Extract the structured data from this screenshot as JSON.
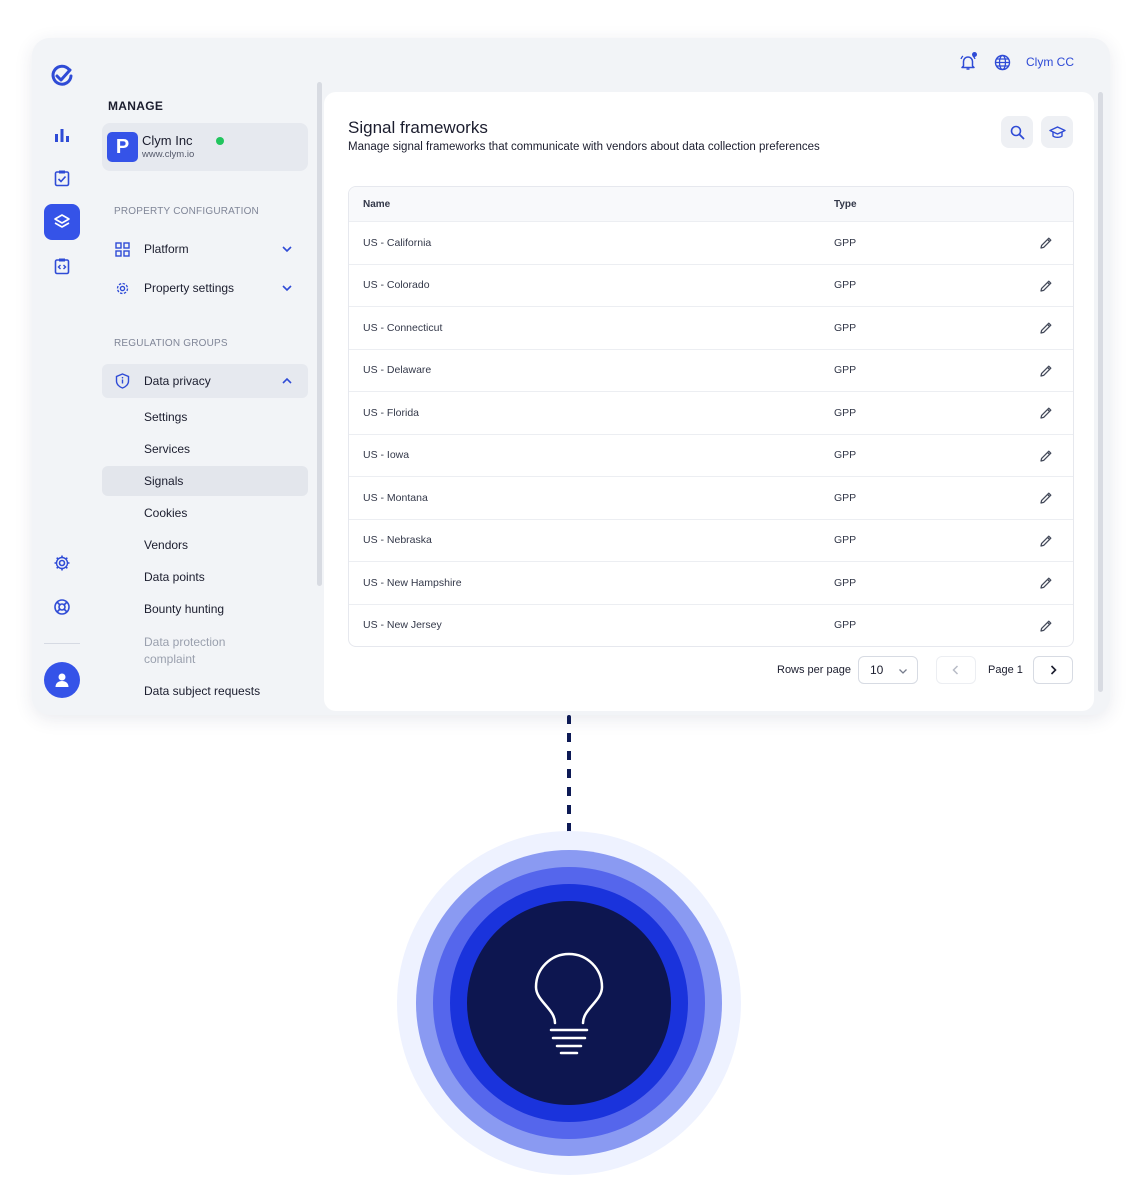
{
  "rail": {
    "icons": [
      "clym-logo-icon",
      "bar-chart-icon",
      "clipboard-check-icon",
      "layers-icon",
      "code-clipboard-icon",
      "gear-icon",
      "lifebuoy-icon",
      "user-icon"
    ],
    "accent": "#3553e8"
  },
  "topbar": {
    "user_label": "Clym CC"
  },
  "sidebar": {
    "manage_label": "MANAGE",
    "org": {
      "initial": "P",
      "name": "Clym Inc",
      "url": "www.clym.io",
      "status_color": "#22c55e"
    },
    "property_config_label": "PROPERTY CONFIGURATION",
    "platform_label": "Platform",
    "property_settings_label": "Property settings",
    "regulation_groups_label": "REGULATION GROUPS",
    "data_privacy_label": "Data privacy",
    "sub_items": [
      "Settings",
      "Services",
      "Signals",
      "Cookies",
      "Vendors",
      "Data points",
      "Bounty hunting",
      "Data protection complaint",
      "Data subject requests"
    ],
    "active_item": "Signals"
  },
  "main": {
    "title": "Signal frameworks",
    "subtitle": "Manage signal frameworks that communicate with vendors about data collection preferences",
    "table": {
      "headers": [
        "Name",
        "Type"
      ],
      "rows": [
        [
          "US - California",
          "GPP"
        ],
        [
          "US - Colorado",
          "GPP"
        ],
        [
          "US - Connecticut",
          "GPP"
        ],
        [
          "US - Delaware",
          "GPP"
        ],
        [
          "US - Florida",
          "GPP"
        ],
        [
          "US - Iowa",
          "GPP"
        ],
        [
          "US - Montana",
          "GPP"
        ],
        [
          "US - Nebraska",
          "GPP"
        ],
        [
          "US - New Hampshire",
          "GPP"
        ],
        [
          "US - New Jersey",
          "GPP"
        ]
      ]
    },
    "pagination": {
      "rows_per_page_label": "Rows per page",
      "rows_per_page": "10",
      "page_label": "Page 1"
    }
  },
  "illustration": {
    "icon": "lightbulb-icon",
    "ring_colors": [
      "#eef2ff",
      "#8a9af2",
      "#5566ec",
      "#1a33dc",
      "#0d1650"
    ]
  }
}
